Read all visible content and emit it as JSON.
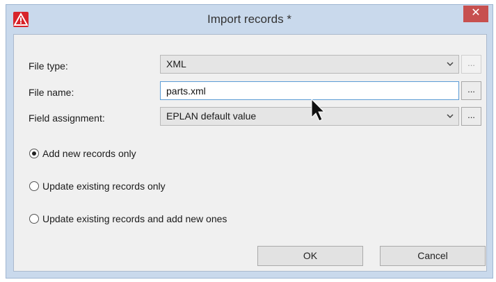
{
  "window": {
    "title": "Import records *",
    "close_glyph": "✕",
    "app_icon": "warning-triangle-icon",
    "brand_color": "#d8232a"
  },
  "form": {
    "file_type": {
      "label": "File type:",
      "value": "XML",
      "browse_label": "..."
    },
    "file_name": {
      "label": "File name:",
      "value": "parts.xml",
      "browse_label": "..."
    },
    "field_assignment": {
      "label": "Field assignment:",
      "value": "EPLAN default value",
      "browse_label": "..."
    }
  },
  "options": [
    {
      "label": "Add new records only",
      "checked": true
    },
    {
      "label": "Update existing records only",
      "checked": false
    },
    {
      "label": "Update existing records and add new ones",
      "checked": false
    }
  ],
  "buttons": {
    "ok": "OK",
    "cancel": "Cancel"
  }
}
